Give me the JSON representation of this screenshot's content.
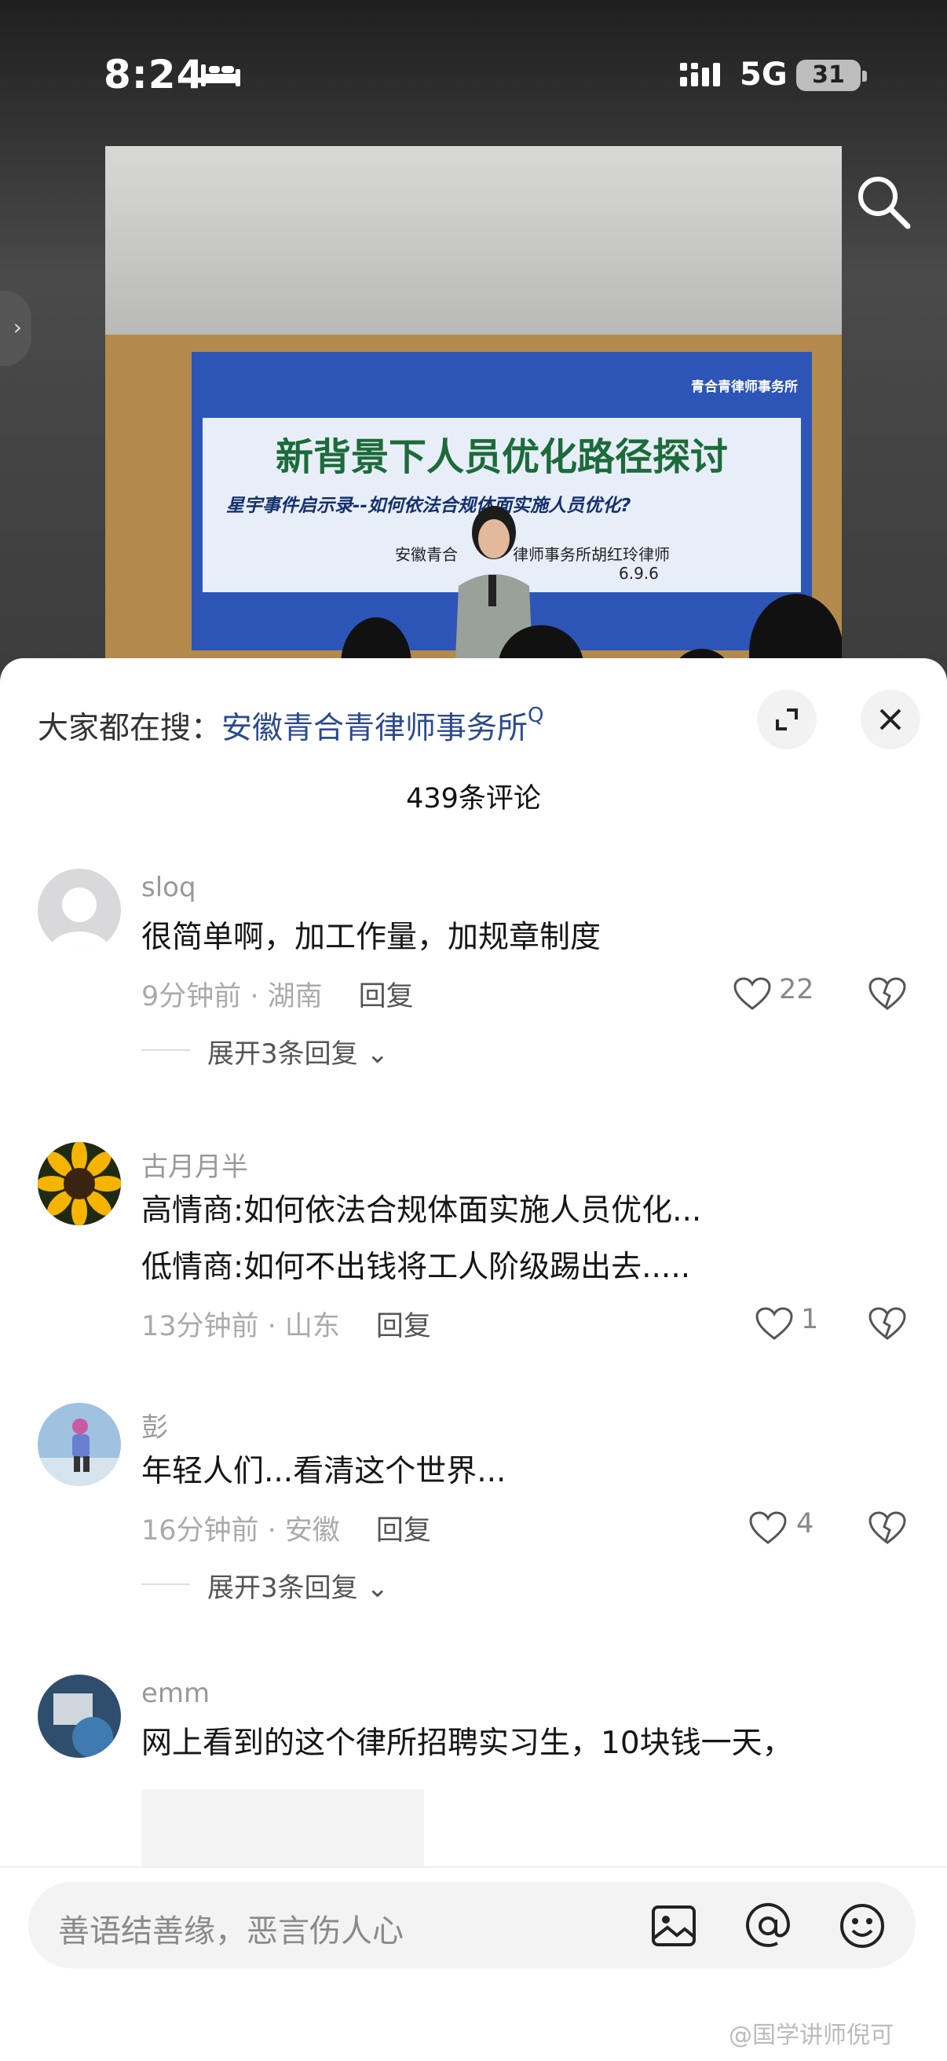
{
  "status_bar": {
    "time": "8:24",
    "network": "5G",
    "battery": "31"
  },
  "photo": {
    "screen_logo": "青合青律师事务所",
    "screen_title": "新背景下人员优化路径探讨",
    "screen_subtitle": "星宇事件启示录--如何依法合规体面实施人员优化?",
    "screen_author": "安徽青合",
    "screen_author_tail": "律师事务所胡红玲律师",
    "screen_date": "6.9.6"
  },
  "sheet": {
    "hot_search_prefix": "大家都在搜：",
    "hot_search_link": "安徽青合青律师事务所",
    "hot_search_q": "Q",
    "comment_count": "439条评论"
  },
  "comments": [
    {
      "user": "sloq",
      "lines": [
        "很简单啊，加工作量，加规章制度"
      ],
      "time": "9分钟前 · 湖南",
      "reply": "回复",
      "likes": "22",
      "expand": "展开3条回复 ⌄"
    },
    {
      "user": "古月月半",
      "lines": [
        "高情商:如何依法合规体面实施人员优化...",
        "低情商:如何不出钱将工人阶级踢出去....."
      ],
      "time": "13分钟前 · 山东",
      "reply": "回复",
      "likes": "1"
    },
    {
      "user": "彭",
      "lines": [
        "年轻人们...看清这个世界..."
      ],
      "time": "16分钟前 · 安徽",
      "reply": "回复",
      "likes": "4",
      "expand": "展开3条回复 ⌄"
    },
    {
      "user": "emm",
      "lines": [
        "网上看到的这个律所招聘实习生，10块钱一天，"
      ]
    }
  ],
  "input": {
    "placeholder": "善语结善缘，恶言伤人心"
  },
  "watermark": "@国学讲师倪可",
  "icons": [
    "bed-icon",
    "signal-icon",
    "search-icon",
    "side-chevron-icon",
    "expand-icon",
    "close-icon",
    "heart-icon",
    "broken-heart-icon",
    "image-icon",
    "at-icon",
    "emoji-icon"
  ]
}
